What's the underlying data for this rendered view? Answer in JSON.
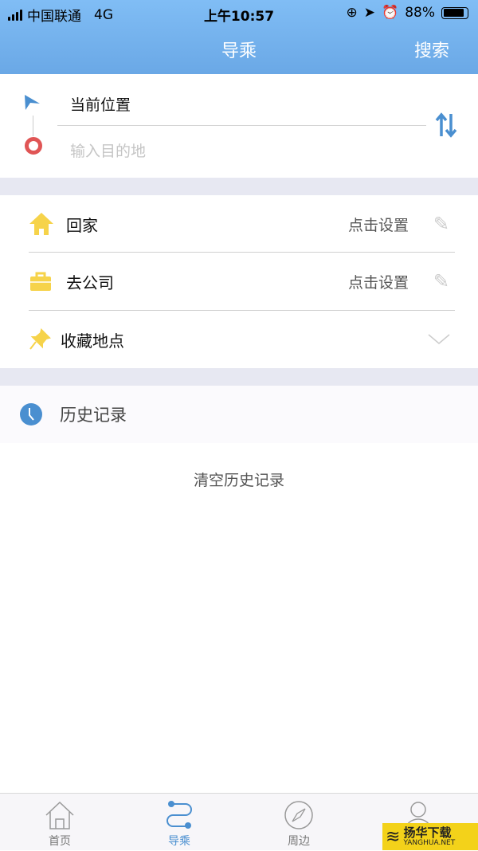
{
  "status_bar": {
    "carrier": "中国联通",
    "network": "4G",
    "time": "上午10:57",
    "battery": "88%",
    "battery_level": 0.88
  },
  "header": {
    "title": "导乘",
    "search_label": "搜索"
  },
  "route": {
    "origin": "当前位置",
    "destination_placeholder": "输入目的地"
  },
  "places": [
    {
      "label": "回家",
      "action": "点击设置",
      "icon": "home-icon"
    },
    {
      "label": "去公司",
      "action": "点击设置",
      "icon": "briefcase-icon"
    },
    {
      "label": "收藏地点",
      "icon": "pin-icon"
    }
  ],
  "history": {
    "title": "历史记录",
    "clear_label": "清空历史记录"
  },
  "tabs": [
    {
      "label": "首页"
    },
    {
      "label": "导乘",
      "active": true
    },
    {
      "label": "周边"
    }
  ],
  "watermark": {
    "cn": "扬华下载",
    "en": "YANGHUA.NET"
  },
  "colors": {
    "accent": "#4a8fd0",
    "home": "#f6d34a",
    "destination": "#e05555"
  }
}
